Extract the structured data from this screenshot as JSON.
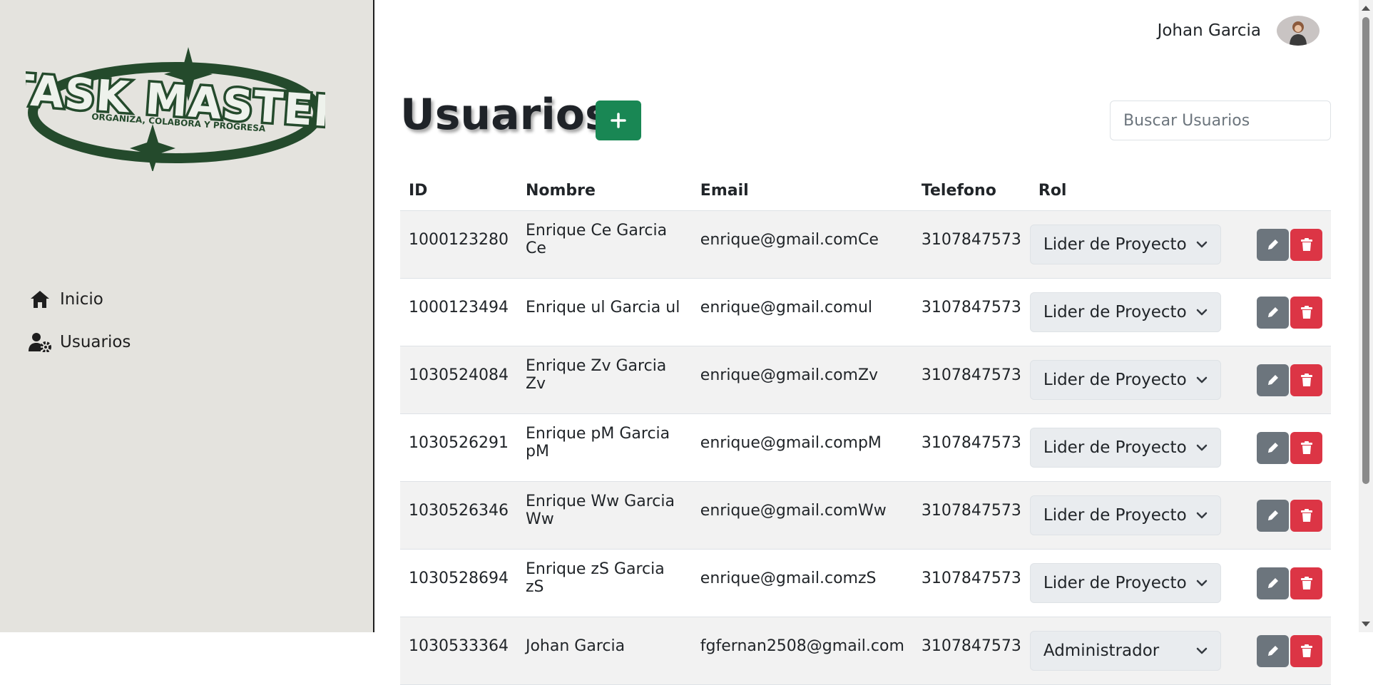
{
  "sidebar": {
    "logo": {
      "title": "TASK MASTER",
      "tagline": "ORGANIZA, COLABORA Y PROGRESA",
      "color": "#244a2c"
    },
    "items": [
      {
        "label": "Inicio",
        "icon": "home-icon"
      },
      {
        "label": "Usuarios",
        "icon": "user-gear-icon"
      }
    ]
  },
  "header": {
    "user_name": "Johan Garcia",
    "avatar": "avatar"
  },
  "main": {
    "title": "Usuarios",
    "add_icon": "plus-icon",
    "search_placeholder": "Buscar Usuarios",
    "table": {
      "columns": [
        "ID",
        "Nombre",
        "Email",
        "Telefono",
        "Rol"
      ],
      "rows": [
        {
          "id": "1000123280",
          "nombre": "Enrique Ce Garcia Ce",
          "email": "enrique@gmail.comCe",
          "telefono": "3107847573",
          "rol": "Lider de Proyecto"
        },
        {
          "id": "1000123494",
          "nombre": "Enrique ul Garcia ul",
          "email": "enrique@gmail.comul",
          "telefono": "3107847573",
          "rol": "Lider de Proyecto"
        },
        {
          "id": "1030524084",
          "nombre": "Enrique Zv Garcia Zv",
          "email": "enrique@gmail.comZv",
          "telefono": "3107847573",
          "rol": "Lider de Proyecto"
        },
        {
          "id": "1030526291",
          "nombre": "Enrique pM Garcia pM",
          "email": "enrique@gmail.compM",
          "telefono": "3107847573",
          "rol": "Lider de Proyecto"
        },
        {
          "id": "1030526346",
          "nombre": "Enrique Ww Garcia Ww",
          "email": "enrique@gmail.comWw",
          "telefono": "3107847573",
          "rol": "Lider de Proyecto"
        },
        {
          "id": "1030528694",
          "nombre": "Enrique zS Garcia zS",
          "email": "enrique@gmail.comzS",
          "telefono": "3107847573",
          "rol": "Lider de Proyecto"
        },
        {
          "id": "1030533364",
          "nombre": "Johan Garcia",
          "email": "fgfernan2508@gmail.com",
          "telefono": "3107847573",
          "rol": "Administrador"
        }
      ]
    }
  },
  "colors": {
    "sidebar_bg": "#e4e3de",
    "success": "#198754",
    "danger": "#dc3545",
    "secondary": "#6c757d"
  }
}
